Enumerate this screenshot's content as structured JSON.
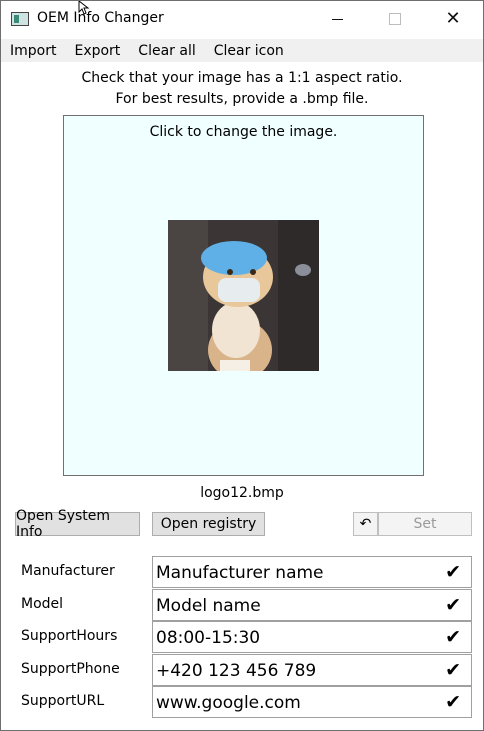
{
  "window": {
    "title": "OEM Info Changer",
    "close_glyph": "✕"
  },
  "menu": [
    "Import",
    "Export",
    "Clear all",
    "Clear icon"
  ],
  "hints": {
    "line1": "Check that your image has a 1:1 aspect ratio.",
    "line2": "For best results, provide a .bmp file."
  },
  "image_area": {
    "caption": "Click to change the image.",
    "background": "#f0ffff",
    "file_name": "logo12.bmp"
  },
  "buttons": {
    "open_system_info": "Open System Info",
    "open_registry": "Open registry",
    "undo_icon": "undo-icon",
    "undo_glyph": "↶",
    "set": "Set"
  },
  "fields": [
    {
      "label": "Manufacturer",
      "value": "Manufacturer name"
    },
    {
      "label": "Model",
      "value": "Model name"
    },
    {
      "label": "SupportHours",
      "value": "08:00-15:30"
    },
    {
      "label": "SupportPhone",
      "value": "+420 123 456 789"
    },
    {
      "label": "SupportURL",
      "value": "www.google.com"
    }
  ],
  "check_glyph": "✔"
}
